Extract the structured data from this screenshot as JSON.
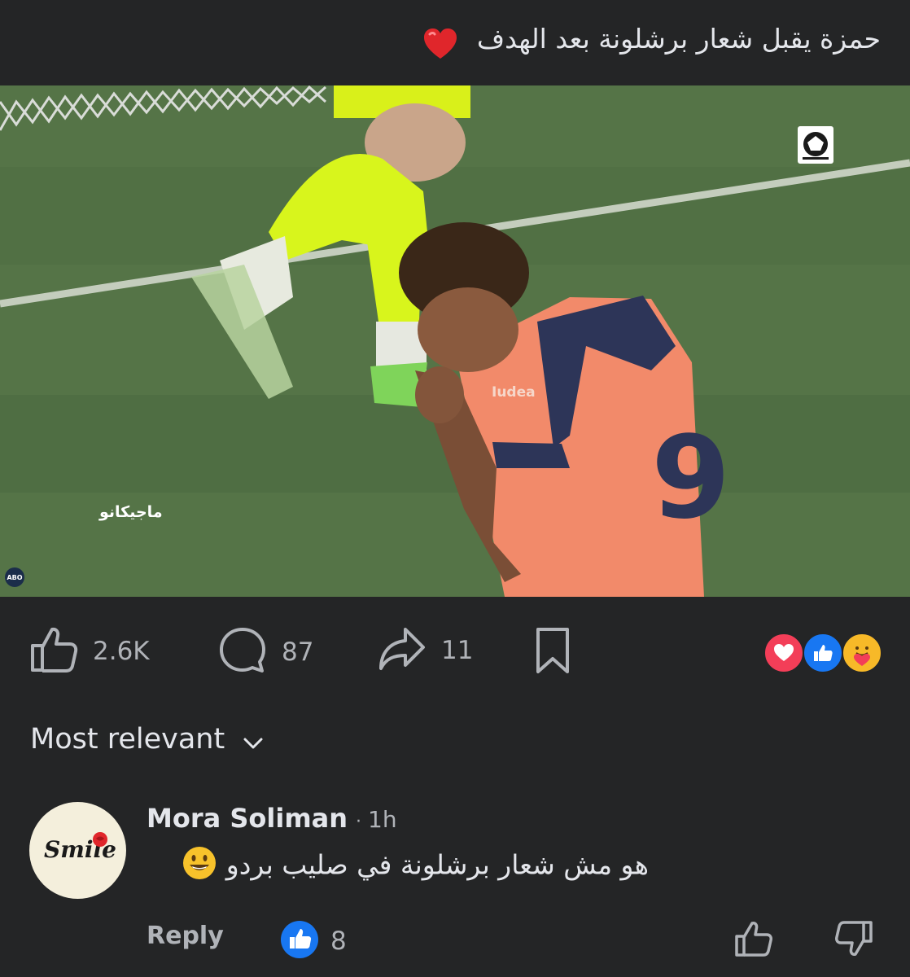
{
  "post": {
    "caption": "حمزة يقبل شعار برشلونة بعد الهدف",
    "caption_emoji": "red-heart"
  },
  "media": {
    "channel_watermark": "ماجيكانو",
    "corner_badge": "ABO"
  },
  "actions": {
    "like_count": "2.6K",
    "comment_count": "87",
    "share_count": "11"
  },
  "reactions": [
    "love",
    "like",
    "care"
  ],
  "colors": {
    "background": "#242526",
    "text_primary": "#e4e6eb",
    "text_secondary": "#b0b3b8",
    "like_blue": "#1877f2",
    "love_red": "#f33e58"
  },
  "sort": {
    "label": "Most relevant"
  },
  "comments": [
    {
      "author": "Mora Soliman",
      "time": "1h",
      "avatar_text": "Smile",
      "text": "هو مش شعار برشلونة في صليب بردو",
      "reply_label": "Reply",
      "like_count": "8"
    }
  ]
}
